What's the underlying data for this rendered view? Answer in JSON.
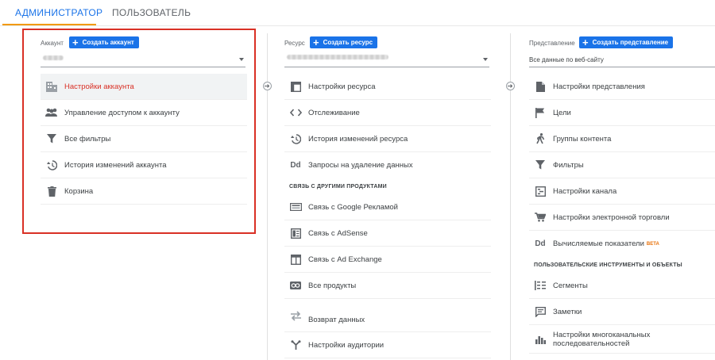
{
  "tabs": {
    "admin": "АДМИНИСТРАТОР",
    "user": "ПОЛЬЗОВАТЕЛЬ"
  },
  "account": {
    "label": "Аккаунт",
    "create_button": "Создать аккаунт",
    "items": [
      {
        "label": "Настройки аккаунта",
        "icon": "building-icon",
        "active": true
      },
      {
        "label": "Управление доступом к аккаунту",
        "icon": "people-icon"
      },
      {
        "label": "Все фильтры",
        "icon": "filter-icon"
      },
      {
        "label": "История изменений аккаунта",
        "icon": "history-icon"
      },
      {
        "label": "Корзина",
        "icon": "trash-icon"
      }
    ]
  },
  "property": {
    "label": "Ресурс",
    "create_button": "Создать ресурс",
    "items": [
      {
        "label": "Настройки ресурса",
        "icon": "window-icon"
      },
      {
        "label": "Отслеживание",
        "icon": "code-icon"
      },
      {
        "label": "История изменений ресурса",
        "icon": "history-icon"
      },
      {
        "label": "Запросы на удаление данных",
        "icon": "dd-icon"
      }
    ],
    "section_title": "СВЯЗЬ С ДРУГИМИ ПРОДУКТАМИ",
    "links": [
      {
        "label": "Связь с Google Рекламой",
        "icon": "ads-icon"
      },
      {
        "label": "Связь с AdSense",
        "icon": "adsense-icon"
      },
      {
        "label": "Связь с Ad Exchange",
        "icon": "adexchange-icon"
      },
      {
        "label": "Все продукты",
        "icon": "link-icon"
      },
      {
        "label": "Возврат данных",
        "icon": "swap-icon"
      },
      {
        "label": "Настройки аудитории",
        "icon": "audience-icon"
      }
    ]
  },
  "view": {
    "label": "Представление",
    "create_button": "Создать представление",
    "selected": "Все данные по веб-сайту",
    "items": [
      {
        "label": "Настройки представления",
        "icon": "document-icon"
      },
      {
        "label": "Цели",
        "icon": "flag-icon"
      },
      {
        "label": "Группы контента",
        "icon": "walking-icon"
      },
      {
        "label": "Фильтры",
        "icon": "filter-icon"
      },
      {
        "label": "Настройки канала",
        "icon": "channel-icon"
      },
      {
        "label": "Настройки электронной торговли",
        "icon": "cart-icon"
      },
      {
        "label": "Вычисляемые показатели",
        "beta": "BETA",
        "icon": "dd-icon"
      }
    ],
    "section_title": "ПОЛЬЗОВАТЕЛЬСКИЕ ИНСТРУМЕНТЫ И ОБЪЕКТЫ",
    "tools": [
      {
        "label": "Сегменты",
        "icon": "segments-icon"
      },
      {
        "label": "Заметки",
        "icon": "comment-icon"
      },
      {
        "label_line1": "Настройки многоканальных",
        "label_line2": "последовательностей",
        "icon": "bar-chart-icon"
      }
    ]
  },
  "colors": {
    "accent": "#1a73e8",
    "active_text": "#d93025",
    "tab_underline": "#f29900",
    "highlight": "#d93025"
  }
}
